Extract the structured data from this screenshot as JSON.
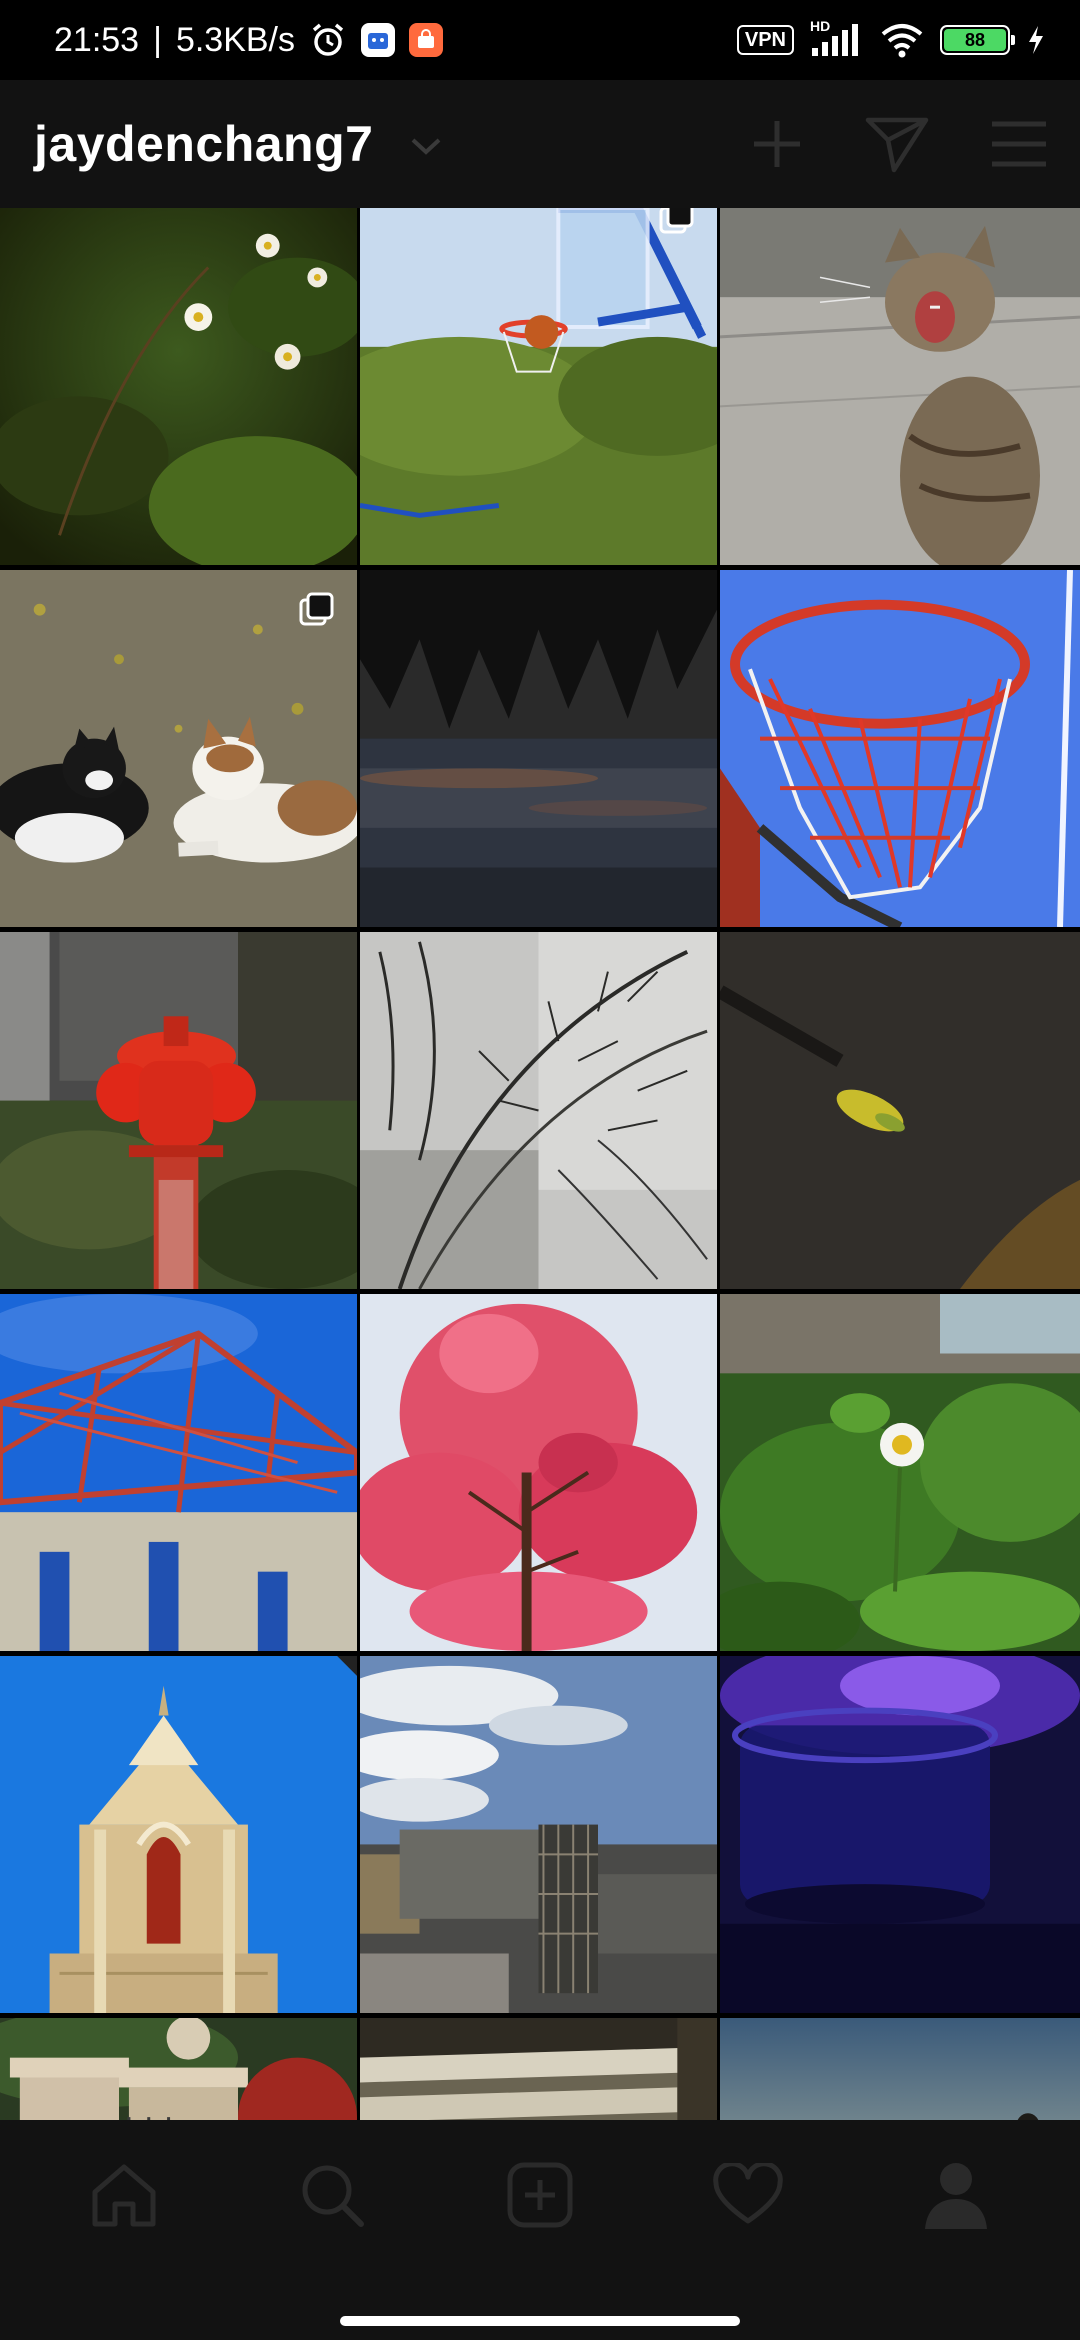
{
  "status_bar": {
    "time": "21:53",
    "separator": "|",
    "net_speed": "5.3KB/s",
    "vpn_label": "VPN",
    "network_label": "HD",
    "battery_level": "88",
    "icons": [
      "alarm-icon",
      "app-notification-icon",
      "app-notification-icon-2",
      "signal-icon",
      "wifi-icon",
      "battery-icon",
      "charging-icon"
    ]
  },
  "header": {
    "username": "jaydenchang7",
    "icons": [
      "chevron-down-icon",
      "plus-icon",
      "send-icon",
      "menu-icon"
    ]
  },
  "grid": {
    "tiles": [
      {
        "subject": "white wildflowers with green leaves",
        "multi": false
      },
      {
        "subject": "basketball hoop with ball, trees",
        "multi": true
      },
      {
        "subject": "tabby cat meowing",
        "multi": false
      },
      {
        "subject": "two cats lying on pavement",
        "multi": true
      },
      {
        "subject": "trees reflected in dark water",
        "multi": false
      },
      {
        "subject": "basketball hoop red net against blue backboard",
        "multi": false
      },
      {
        "subject": "red fire hydrant",
        "multi": false
      },
      {
        "subject": "grass plumes silhouette",
        "multi": false
      },
      {
        "subject": "yellow leaf on asphalt",
        "multi": false
      },
      {
        "subject": "red steel frame against blue sky",
        "multi": false
      },
      {
        "subject": "pink blossom tree",
        "multi": false
      },
      {
        "subject": "white flower among green leaves",
        "multi": false
      },
      {
        "subject": "church tower against blue sky",
        "multi": false
      },
      {
        "subject": "building under construction with scaffolding",
        "multi": false
      },
      {
        "subject": "glass under blue-purple light",
        "multi": false
      },
      {
        "subject": "stone gate pillars",
        "multi": false
      },
      {
        "subject": "shadows on steps",
        "multi": false
      },
      {
        "subject": "people silhouetted at sunset",
        "multi": false
      }
    ]
  },
  "bottom_nav": {
    "items": [
      "home-icon",
      "search-icon",
      "new-post-icon",
      "activity-heart-icon",
      "profile-icon"
    ]
  },
  "colors": {
    "background": "#000000",
    "header_bg": "#121212",
    "battery_green": "#4cd964"
  }
}
